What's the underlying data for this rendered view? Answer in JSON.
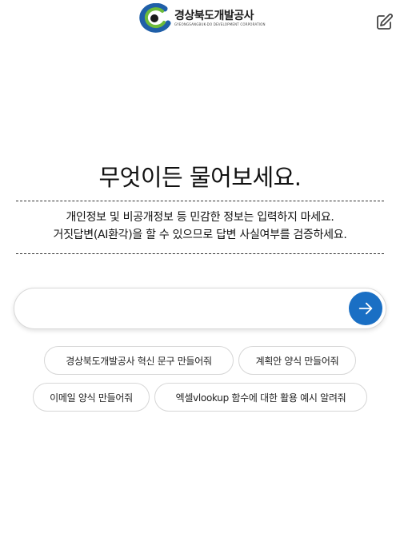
{
  "header": {
    "logo_name": "경상북도개발공사",
    "logo_sub": "GYEONGSANGBUK-DO DEVELOPMENT CORPORATION",
    "new_chat_icon": "edit-icon"
  },
  "main": {
    "title": "무엇이든 물어보세요.",
    "notice_line1": "개인정보 및 비공개정보 등 민감한 정보는 입력하지 마세요.",
    "notice_line2": "거짓답변(AI환각)을 할 수 있으므로 답변 사실여부를 검증하세요."
  },
  "input": {
    "value": "",
    "placeholder": "",
    "send_icon": "arrow-right-icon"
  },
  "suggestions": [
    "경상북도개발공사 혁신 문구 만들어줘",
    "계획안 양식 만들어줘",
    "이메일 양식 만들어줘",
    "엑셀vlookup 함수에 대한 활용 예시 알려줘"
  ],
  "colors": {
    "accent": "#1a6fc4",
    "logo_green": "#6dbb3a",
    "logo_blue": "#1f5fa8"
  }
}
